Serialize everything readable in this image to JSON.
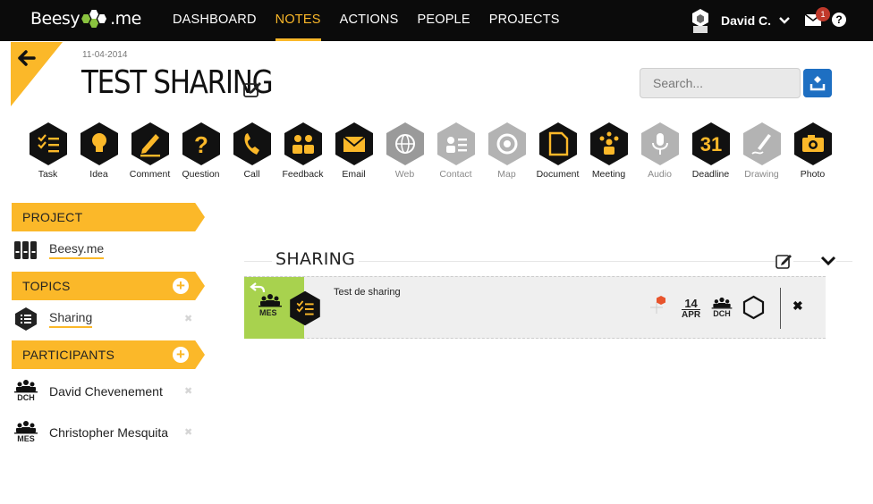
{
  "app": {
    "logo_text": "Beesy",
    "logo_suffix": ".me"
  },
  "nav": [
    {
      "label": "DASHBOARD"
    },
    {
      "label": "NOTES",
      "active": true
    },
    {
      "label": "ACTIONS"
    },
    {
      "label": "PEOPLE"
    },
    {
      "label": "PROJECTS"
    }
  ],
  "user": {
    "name": "David C.",
    "unread_count": "1",
    "help": "?"
  },
  "note": {
    "date": "11-04-2014",
    "title": "TEST SHARING"
  },
  "search": {
    "placeholder": "Search..."
  },
  "tools": [
    {
      "label": "Task",
      "icon": "task-icon",
      "enabled": true
    },
    {
      "label": "Idea",
      "icon": "idea-icon",
      "enabled": true
    },
    {
      "label": "Comment",
      "icon": "comment-icon",
      "enabled": true
    },
    {
      "label": "Question",
      "icon": "question-icon",
      "enabled": true
    },
    {
      "label": "Call",
      "icon": "call-icon",
      "enabled": true
    },
    {
      "label": "Feedback",
      "icon": "feedback-icon",
      "enabled": true
    },
    {
      "label": "Email",
      "icon": "email-icon",
      "enabled": true
    },
    {
      "label": "Web",
      "icon": "web-icon",
      "enabled": false
    },
    {
      "label": "Contact",
      "icon": "contact-icon",
      "enabled": false
    },
    {
      "label": "Map",
      "icon": "map-icon",
      "enabled": false
    },
    {
      "label": "Document",
      "icon": "document-icon",
      "enabled": true
    },
    {
      "label": "Meeting",
      "icon": "meeting-icon",
      "enabled": true
    },
    {
      "label": "Audio",
      "icon": "audio-icon",
      "enabled": false
    },
    {
      "label": "Deadline",
      "icon": "deadline-icon",
      "enabled": true,
      "glyph": "31"
    },
    {
      "label": "Drawing",
      "icon": "drawing-icon",
      "enabled": false
    },
    {
      "label": "Photo",
      "icon": "photo-icon",
      "enabled": true
    }
  ],
  "sidebar": {
    "project": {
      "heading": "PROJECT",
      "name": "Beesy.me"
    },
    "topics": {
      "heading": "TOPICS",
      "items": [
        {
          "name": "Sharing"
        }
      ]
    },
    "participants": {
      "heading": "PARTICIPANTS",
      "items": [
        {
          "initials": "DCH",
          "name": "David Chevenement"
        },
        {
          "initials": "MES",
          "name": "Christopher Mesquita"
        }
      ]
    }
  },
  "topic_panel": {
    "title": "SHARING",
    "item": {
      "owner_initials": "MES",
      "text": "Test de sharing",
      "due_day": "14",
      "due_month": "APR",
      "assignee_initials": "DCH"
    }
  },
  "colors": {
    "accent": "#fbb829",
    "green": "#a8d24e",
    "brand_blue": "#1e6fc2",
    "dark": "#0b0b0b"
  }
}
